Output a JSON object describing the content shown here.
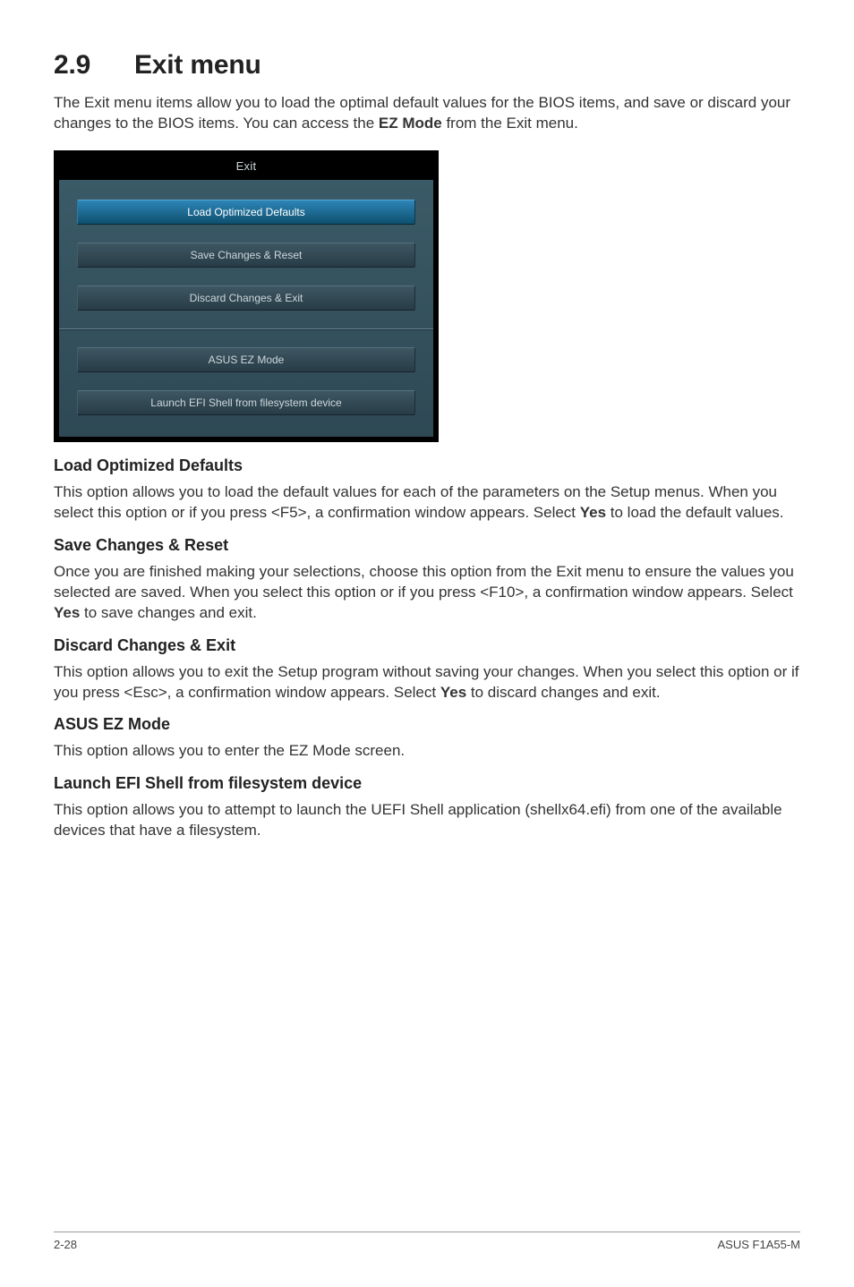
{
  "heading": {
    "number": "2.9",
    "title": "Exit menu"
  },
  "intro": {
    "text_before": "The Exit menu items allow you to load the optimal default values for the BIOS items, and save or discard your changes to the BIOS items. You can access the ",
    "bold": "EZ Mode",
    "text_after": " from the Exit menu."
  },
  "bios": {
    "title": "Exit",
    "items": [
      {
        "label": "Load Optimized Defaults",
        "active": true
      },
      {
        "label": "Save Changes & Reset",
        "active": false
      },
      {
        "label": "Discard Changes & Exit",
        "active": false
      }
    ],
    "items2": [
      {
        "label": "ASUS EZ Mode",
        "active": false
      },
      {
        "label": "Launch EFI Shell from filesystem device",
        "active": false
      }
    ]
  },
  "sections": {
    "load": {
      "title": "Load Optimized Defaults",
      "p1a": "This option allows you to load the default values for each of the parameters on the Setup menus. When you select this option or if you press <F5>, a confirmation window appears. Select ",
      "p1b": "Yes",
      "p1c": " to load the default values."
    },
    "save": {
      "title": "Save Changes & Reset",
      "p1a": "Once you are finished making your selections, choose this option from the Exit menu to ensure the values you selected are saved. When you select this option or if you press <F10>, a confirmation window appears. Select ",
      "p1b": "Yes",
      "p1c": " to save changes and exit."
    },
    "discard": {
      "title": "Discard Changes & Exit",
      "p1a": "This option allows you to exit the Setup program without saving your changes. When you select this option or if you press <Esc>, a confirmation window appears. Select ",
      "p1b": "Yes",
      "p1c": " to discard changes and exit."
    },
    "ez": {
      "title": "ASUS EZ Mode",
      "p1": "This option allows you to enter the EZ Mode screen."
    },
    "efi": {
      "title": "Launch EFI Shell from filesystem device",
      "p1": "This option allows you to attempt to launch the UEFI Shell application (shellx64.efi) from one of the available devices that have a filesystem."
    }
  },
  "footer": {
    "left": "2-28",
    "right": "ASUS F1A55-M"
  }
}
